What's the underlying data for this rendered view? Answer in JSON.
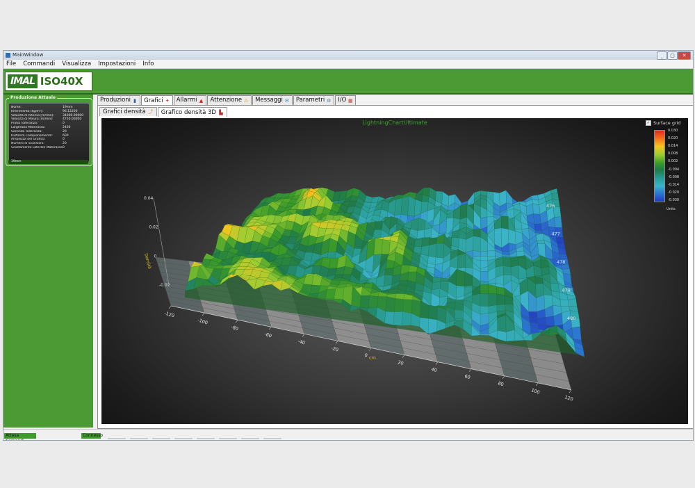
{
  "window": {
    "title": "MainWindow",
    "minimize": "_",
    "maximize": "▢",
    "close": "✕"
  },
  "menu": [
    "File",
    "Commandi",
    "Visualizza",
    "Impostazioni",
    "Info"
  ],
  "logo": {
    "mark": "IMAL",
    "text": "ISO40X"
  },
  "production": {
    "title": "Produzione Attuale",
    "rows": [
      {
        "label": "Nome:",
        "value": "19mm"
      },
      {
        "label": "Riferimento [kg/m³]:",
        "value": "96.12200"
      },
      {
        "label": "Velocità di Ritorno [m/min]:",
        "value": "34000.00000"
      },
      {
        "label": "Velocità di Misura [m/min]:",
        "value": "4750.00000"
      },
      {
        "label": "Prima Tolleranza:",
        "value": "0"
      },
      {
        "label": "Larghezza Materasso:",
        "value": "2400"
      },
      {
        "label": "Seconda Tolleranza:",
        "value": "20"
      },
      {
        "label": "Distanza Campionamento:",
        "value": "600"
      },
      {
        "label": "Ampiezza del Grafico:",
        "value": "0"
      },
      {
        "label": "Numero di Scansioni:",
        "value": "20"
      },
      {
        "label": "Scostamento Laterale Materasso:",
        "value": "0"
      }
    ],
    "footer": "19mm"
  },
  "tabs": [
    {
      "label": "Produzioni",
      "icon": "book-icon",
      "glyph": "▮",
      "color": "#2f5ea8",
      "active": false
    },
    {
      "label": "Grafici",
      "icon": "chart-icon",
      "glyph": "✦",
      "color": "#c23b3b",
      "active": true
    },
    {
      "label": "Allarmi",
      "icon": "alarm-icon",
      "glyph": "▲",
      "color": "#d62020",
      "active": false
    },
    {
      "label": "Attenzione",
      "icon": "warning-icon",
      "glyph": "⚠",
      "color": "#e0a800",
      "active": false
    },
    {
      "label": "Messaggi",
      "icon": "message-icon",
      "glyph": "✉",
      "color": "#3a8ad0",
      "active": false
    },
    {
      "label": "Parametri",
      "icon": "gear-icon",
      "glyph": "⚙",
      "color": "#5a7a9a",
      "active": false
    },
    {
      "label": "I/O",
      "icon": "io-icon",
      "glyph": "▦",
      "color": "#c43a3a",
      "active": false
    }
  ],
  "subtabs": [
    {
      "label": "Grafici densità",
      "icon": "chart-line-icon",
      "glyph": "⤴",
      "color": "#c8a030",
      "active": false
    },
    {
      "label": "Grafico densità 3D",
      "icon": "chart-3d-icon",
      "glyph": "▙",
      "color": "#c03030",
      "active": true
    }
  ],
  "chart_title": "LightningChartUltimate",
  "legend": {
    "checkbox_label": "Surface grid",
    "checked": true,
    "ticks": [
      "0.030",
      "0.020",
      "0.014",
      "0.008",
      "0.002",
      "-0.004",
      "-0.008",
      "-0.014",
      "-0.020",
      "-0.030"
    ],
    "units": "Units"
  },
  "chart_data": {
    "type": "surface",
    "title": "LightningChartUltimate",
    "x_ticks": [
      "-120",
      "-100",
      "-80",
      "-60",
      "-40",
      "-20",
      "0",
      "20",
      "40",
      "60",
      "80",
      "100",
      "120"
    ],
    "y_ticks": [
      "0.04",
      "0.02",
      "0",
      "-0.02"
    ],
    "z_ticks": [
      "476",
      "477",
      "478",
      "479",
      "480"
    ],
    "x_axis_label": "cm",
    "y_axis_label": "Densità",
    "value_range": [
      -0.03,
      0.03
    ],
    "grid": true
  },
  "statusbar": {
    "left": "Attesa Comandi",
    "right": "Connesso"
  }
}
